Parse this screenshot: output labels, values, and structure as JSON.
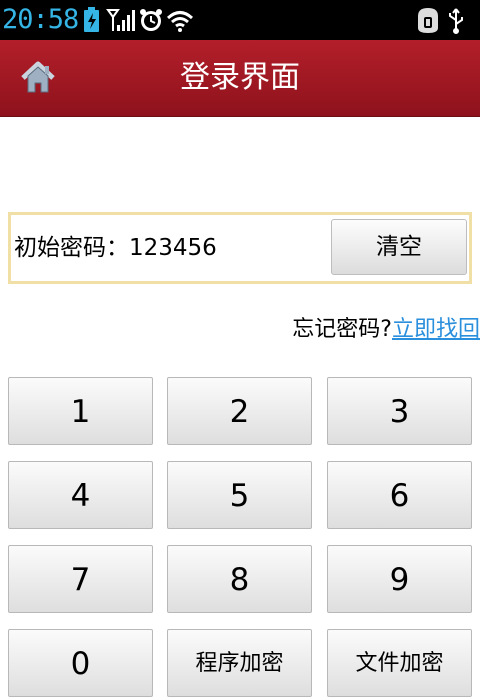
{
  "status_bar": {
    "time": "20:58",
    "icons": [
      "battery-charging-icon",
      "signal-icon",
      "alarm-icon",
      "wifi-icon",
      "usb-storage-icon",
      "usb-icon"
    ]
  },
  "header": {
    "title": "登录界面",
    "home_icon": "home-icon"
  },
  "password": {
    "label": "初始密码：123456",
    "clear_label": "清空"
  },
  "forgot": {
    "text": "忘记密码?",
    "link": "立即找回"
  },
  "keypad": {
    "k1": "1",
    "k2": "2",
    "k3": "3",
    "k4": "4",
    "k5": "5",
    "k6": "6",
    "k7": "7",
    "k8": "8",
    "k9": "9",
    "k0": "0",
    "program_encrypt": "程序加密",
    "file_encrypt": "文件加密"
  }
}
